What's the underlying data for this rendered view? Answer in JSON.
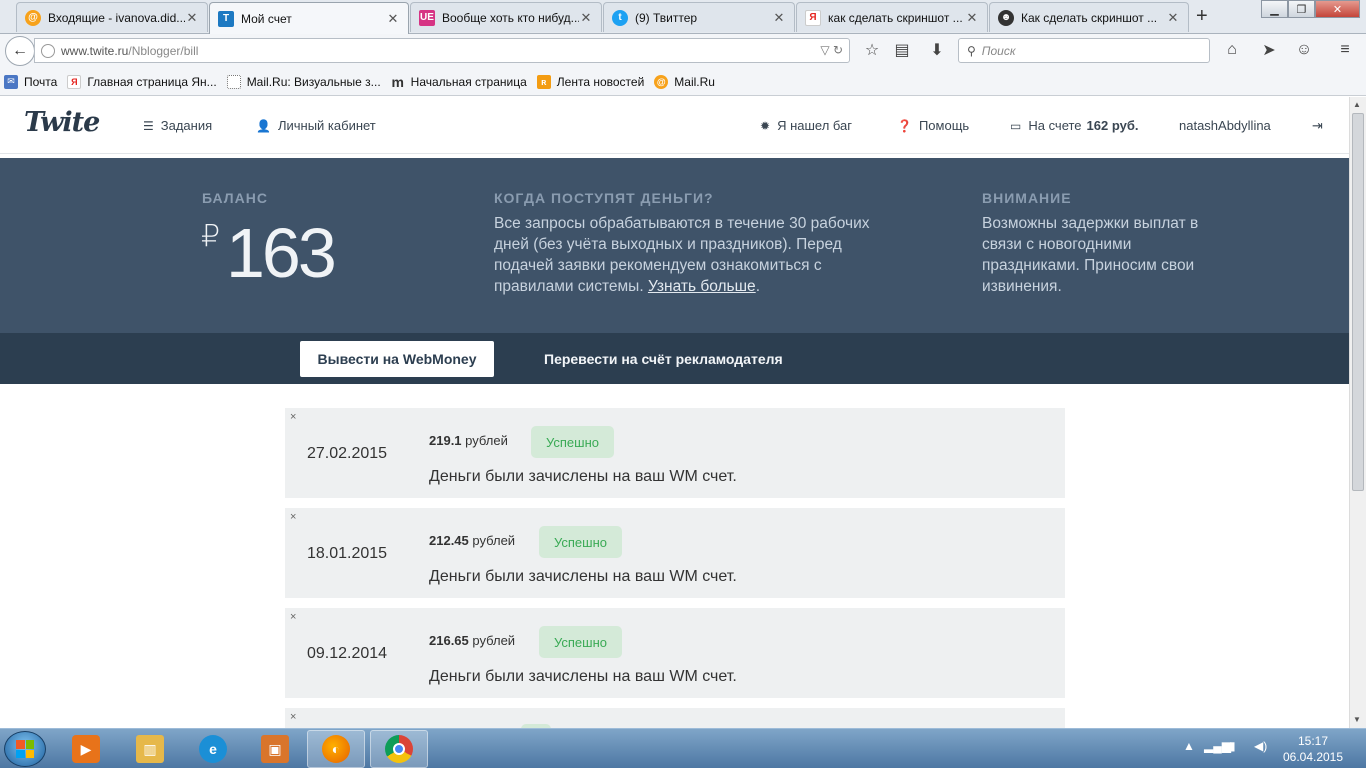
{
  "browser": {
    "tabs": [
      {
        "title": "Входящие - ivanova.did...",
        "icon": "mailru-icon",
        "color": "#f7a21b"
      },
      {
        "title": "Мой счет",
        "icon": "twite-icon",
        "color": "#1d79c2",
        "active": true
      },
      {
        "title": "Вообще хоть кто нибуд...",
        "icon": "ue-icon",
        "color": "#d63384",
        "glyph": "UE"
      },
      {
        "title": "(9) Твиттер",
        "icon": "twitter-icon",
        "color": "#1da1f2"
      },
      {
        "title": "как сделать скриншот ...",
        "icon": "yandex-icon",
        "color": "#e52620",
        "glyph": "Я"
      },
      {
        "title": "Как сделать скриншот ...",
        "icon": "person-icon",
        "color": "#333333"
      }
    ],
    "new_tab_label": "+",
    "url_host": "www.twite.ru",
    "url_path": "/Nblogger/bill",
    "search_placeholder": "Поиск",
    "bookmarks": [
      {
        "label": "Почта",
        "icon": "mail-icon",
        "color": "#4b77c4"
      },
      {
        "label": "Главная страница Ян...",
        "icon": "yandex-icon",
        "color": "#e52620",
        "glyph": "Я"
      },
      {
        "label": "Mail.Ru: Визуальные з...",
        "icon": "page-icon",
        "color": "#ffffff"
      },
      {
        "label": "Начальная страница",
        "icon": "m-icon",
        "color": "#333333",
        "glyph": "m"
      },
      {
        "label": "Лента новостей",
        "icon": "rss-icon",
        "color": "#f39c12"
      },
      {
        "label": "Mail.Ru",
        "icon": "mailru-icon",
        "color": "#f7a21b"
      }
    ]
  },
  "site": {
    "logo": "Twite",
    "nav": {
      "tasks": "Задания",
      "cabinet": "Личный кабинет",
      "bug": "Я нашел баг",
      "help": "Помощь",
      "balance_prefix": "На счете",
      "balance_value": "162 руб.",
      "username": "natashAbdyllina"
    },
    "hero": {
      "balance_heading": "БАЛАНС",
      "currency": "₽",
      "balance_amount": "163",
      "when_heading": "КОГДА ПОСТУПЯТ ДЕНЬГИ?",
      "when_text": "Все запросы обрабатываются в течение 30 рабочих дней (без учёта выходных и праздников). Перед подачей заявки рекомендуем ознакомиться с правилами системы.",
      "when_link": "Узнать больше",
      "when_text_end": ".",
      "attention_heading": "ВНИМАНИЕ",
      "attention_text": "Возможны задержки выплат в связи с новогодними праздниками. Приносим свои извинения."
    },
    "actions": {
      "withdraw_wm": "Вывести на WebMoney",
      "transfer_adv": "Перевести на счёт рекламодателя"
    },
    "records": [
      {
        "date": "27.02.2015",
        "amount": "219.1",
        "unit": "рублей",
        "status": "Успешно",
        "message": "Деньги были зачислены на ваш WM счет."
      },
      {
        "date": "18.01.2015",
        "amount": "212.45",
        "unit": "рублей",
        "status": "Успешно",
        "message": "Деньги были зачислены на ваш WM счет."
      },
      {
        "date": "09.12.2014",
        "amount": "216.65",
        "unit": "рублей",
        "status": "Успешно",
        "message": "Деньги были зачислены на ваш WM счет."
      }
    ],
    "record_close": "×"
  },
  "taskbar": {
    "time": "15:17",
    "date": "06.04.2015",
    "apps": [
      {
        "name": "media-player-icon",
        "color": "#e8731a"
      },
      {
        "name": "file-explorer-icon",
        "color": "#e6b84a"
      },
      {
        "name": "internet-explorer-icon",
        "color": "#1b8fd6"
      },
      {
        "name": "installer-icon",
        "color": "#d9752b"
      },
      {
        "name": "firefox-icon",
        "color": "#e66000"
      },
      {
        "name": "chrome-icon",
        "color": "#3a9a3a"
      }
    ]
  }
}
